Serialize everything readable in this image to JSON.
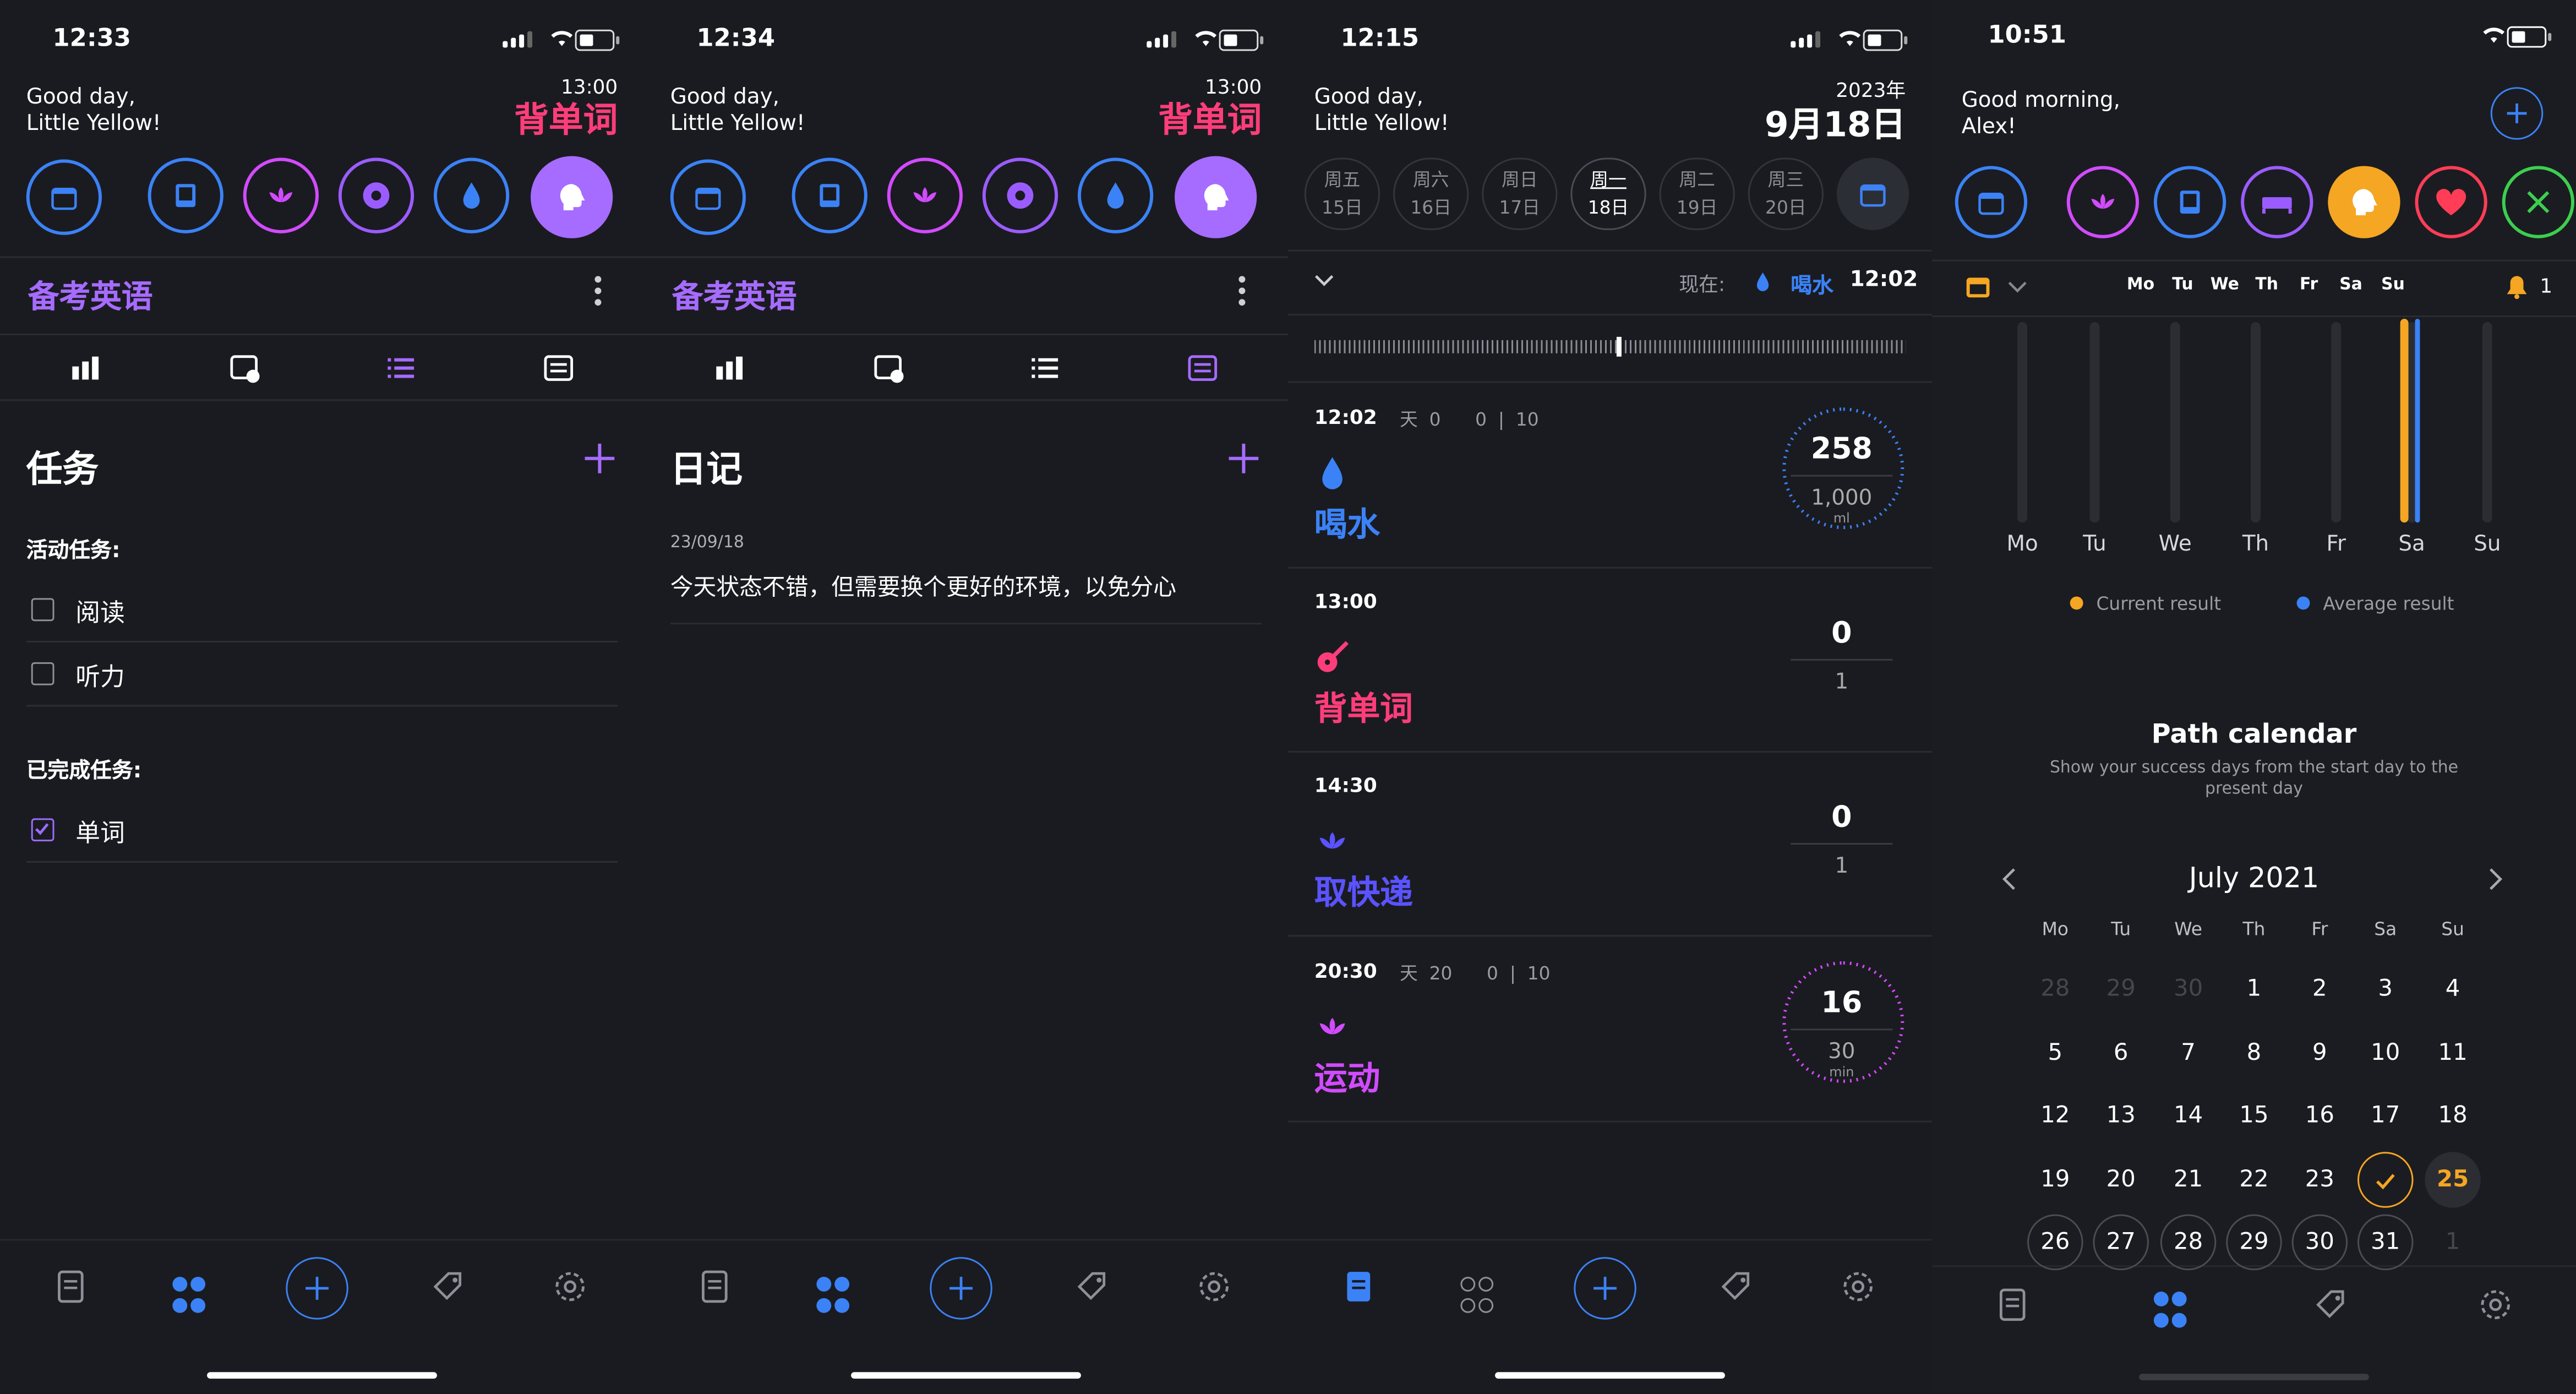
{
  "s1": {
    "time": "12:33",
    "greeting": "Good day,\nLittle Yellow!",
    "next_time": "13:00",
    "next_habit": "背单词",
    "project_title": "备考英语",
    "section_title": "任务",
    "active_label": "活动任务:",
    "active_tasks": [
      "阅读",
      "听力"
    ],
    "done_label": "已完成任务:",
    "done_tasks": [
      "单词"
    ]
  },
  "s2": {
    "time": "12:34",
    "greeting": "Good day,\nLittle Yellow!",
    "next_time": "13:00",
    "next_habit": "背单词",
    "project_title": "备考英语",
    "section_title": "日记",
    "entry_date": "23/09/18",
    "entry_text": "今天状态不错，但需要换个更好的环境，以免分心"
  },
  "s3": {
    "time": "12:15",
    "greeting": "Good day,\nLittle Yellow!",
    "year": "2023年",
    "date": "9月18日",
    "week": [
      {
        "dow": "周五",
        "day": "15日"
      },
      {
        "dow": "周六",
        "day": "16日"
      },
      {
        "dow": "周日",
        "day": "17日"
      },
      {
        "dow": "周一",
        "day": "18日"
      },
      {
        "dow": "周二",
        "day": "19日"
      },
      {
        "dow": "周三",
        "day": "20日"
      }
    ],
    "now_label": "现在:",
    "now_habit": "喝水",
    "now_time": "12:02",
    "habits": [
      {
        "time": "12:02",
        "meta": "天  0      0  |  10",
        "name": "喝水",
        "value": "258",
        "goal": "1,000",
        "unit": "ml",
        "color": "#3b82f6"
      },
      {
        "time": "13:00",
        "meta": "",
        "name": "背单词",
        "value": "0",
        "goal": "1",
        "unit": "",
        "color": "#ff3d7a"
      },
      {
        "time": "14:30",
        "meta": "",
        "name": "取快递",
        "value": "0",
        "goal": "1",
        "unit": "",
        "color": "#5a53ff"
      },
      {
        "time": "20:30",
        "meta": "天  20      0  |  10",
        "name": "运动",
        "value": "16",
        "goal": "30",
        "unit": "min",
        "color": "#d24bff"
      }
    ]
  },
  "s4": {
    "time": "10:51",
    "greeting": "Good morning,\nAlex!",
    "week_header": [
      "Mo",
      "Tu",
      "We",
      "Th",
      "Fr",
      "Sa",
      "Su"
    ],
    "bell_count": "1",
    "chart_days": [
      "Mo",
      "Tu",
      "We",
      "Th",
      "Fr",
      "Sa",
      "Su"
    ],
    "legend_current": "Current result",
    "legend_average": "Average result",
    "path_title": "Path calendar",
    "path_desc": "Show your success days from the start day to the present day",
    "month": "July 2021",
    "cal_head": [
      "Mo",
      "Tu",
      "We",
      "Th",
      "Fr",
      "Sa",
      "Su"
    ],
    "cal_rows": [
      [
        "28",
        "29",
        "30",
        "1",
        "2",
        "3",
        "4"
      ],
      [
        "5",
        "6",
        "7",
        "8",
        "9",
        "10",
        "11"
      ],
      [
        "12",
        "13",
        "14",
        "15",
        "16",
        "17",
        "18"
      ],
      [
        "19",
        "20",
        "21",
        "22",
        "23",
        "",
        "25"
      ],
      [
        "26",
        "27",
        "28",
        "29",
        "30",
        "31",
        "1"
      ]
    ]
  },
  "colors": {
    "accent": "#a66bff",
    "pink": "#ff3d7a",
    "blue": "#3b82f6",
    "orange": "#f5a623"
  }
}
